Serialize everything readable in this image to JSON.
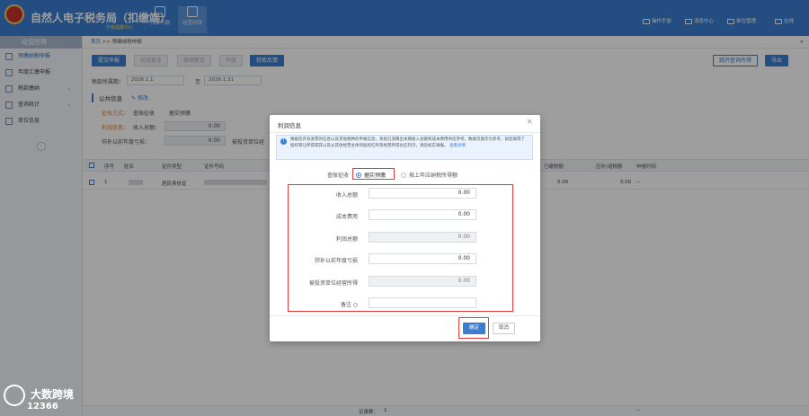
{
  "app": {
    "title": "自然人电子税务局（扣缴端）",
    "subtitle": "升级提醒中心"
  },
  "topnav": [
    {
      "label": "代扣代缴"
    },
    {
      "label": "经营所得"
    }
  ],
  "top_links": [
    "操作手册",
    "消息中心",
    "单位管理",
    "在线"
  ],
  "sidebar": {
    "header": "经营所得",
    "items": [
      {
        "label": "预缴纳税申报",
        "active": true
      },
      {
        "label": "年度汇缴申报"
      },
      {
        "label": "税款缴纳"
      },
      {
        "label": "查询统计"
      },
      {
        "label": "单位信息"
      }
    ]
  },
  "tabstrip": {
    "home": "首页",
    "sep": ">>",
    "current": "预缴纳税申报",
    "close": "×"
  },
  "toolbar": {
    "submit": "提交申报",
    "start_correct": "启动更正",
    "cancel_correct": "撤销更正",
    "void": "作废",
    "get_feedback": "获取反馈",
    "go_query": "跳开查询所得",
    "export": "导出"
  },
  "period": {
    "label": "税款所属期：",
    "start": "2026.1.1",
    "sep": "至",
    "end": "2026.1.31"
  },
  "public_info": {
    "title": "公共信息",
    "edit": "修改",
    "levy_label": "征收方式：",
    "levy_value": "查账征收",
    "levy_value2": "据实预缴",
    "profit_label": "利润信息：",
    "income_label": "收入总额：",
    "income_value": "0.00",
    "loss_label": "弥补以前年度亏损：",
    "loss_value": "0.00",
    "invest_label": "被投资单位经"
  },
  "table": {
    "headers": [
      "序号",
      "姓名",
      "证件类型",
      "证件号码",
      "已缴税额",
      "应补/退税额",
      "申报时间"
    ],
    "rows": [
      {
        "no": "1",
        "id_type": "居民身份证",
        "paid": "0.00",
        "refund": "0.00",
        "time": "--"
      }
    ],
    "footer": {
      "record_count_label": "记录数：",
      "record_count": "1",
      "dash": "--"
    }
  },
  "dialog": {
    "title": "利润信息",
    "close": "×",
    "notice": "根据您开具发票的信息以及其他税种的申报信息，系统已测算出本期收入总额和成本费用供您参考，数据仅能作为参考，如您取得了股权转让所得或其以及从其他经营主体的股权红利等经营所得也应列示，请您如实填报。",
    "notice_link": "查看详情",
    "levy_label": "查账征收",
    "radio_selected": "据实预缴",
    "radio_other": "按上年应纳税所得额",
    "fields": [
      {
        "label": "收入总额",
        "value": "0.00",
        "readonly": false
      },
      {
        "label": "成本费用",
        "value": "0.00",
        "readonly": false
      },
      {
        "label": "利润总额",
        "value": "0.00",
        "readonly": true
      },
      {
        "label": "弥补以前年度亏损",
        "value": "0.00",
        "readonly": false
      },
      {
        "label": "被投资单位经营所得",
        "value": "0.00",
        "readonly": true
      },
      {
        "label": "备注",
        "value": "",
        "readonly": false
      }
    ],
    "ok": "确定",
    "cancel": "取消"
  },
  "watermark": {
    "line1": "大数跨境",
    "line2": "12366"
  }
}
